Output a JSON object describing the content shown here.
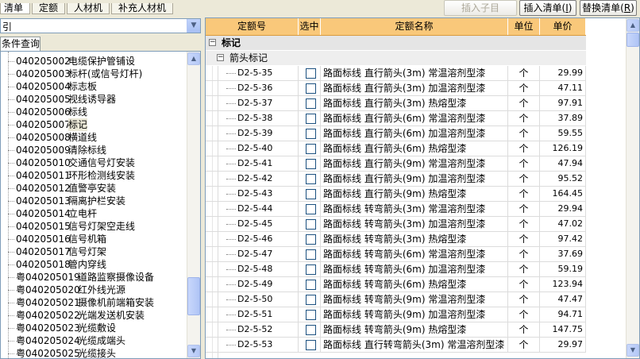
{
  "tabs": [
    "清单",
    "定额",
    "人材机",
    "补充人材机"
  ],
  "toolbar": {
    "insert_child": "插入子目",
    "insert_list": "插入清单(",
    "insert_list_key": "I",
    "insert_list_end": ")",
    "replace_list": "替换清单(",
    "replace_list_key": "R",
    "replace_list_end": ")"
  },
  "left": {
    "combo_value": "引",
    "tab_label": "条件查询",
    "tree": [
      {
        "code": "040205002",
        "name": "电缆保护管铺设"
      },
      {
        "code": "040205003",
        "name": "标杆(或信号灯杆)"
      },
      {
        "code": "040205004",
        "name": "标志板"
      },
      {
        "code": "040205005",
        "name": "视线诱导器"
      },
      {
        "code": "040205006",
        "name": "标线"
      },
      {
        "code": "040205007",
        "name": "标记",
        "selected": true
      },
      {
        "code": "040205008",
        "name": "横道线"
      },
      {
        "code": "040205009",
        "name": "清除标线"
      },
      {
        "code": "040205010",
        "name": "交通信号灯安装"
      },
      {
        "code": "040205011",
        "name": "环形检测线安装"
      },
      {
        "code": "040205012",
        "name": "值警亭安装"
      },
      {
        "code": "040205013",
        "name": "隔离护栏安装"
      },
      {
        "code": "040205014",
        "name": "立电杆"
      },
      {
        "code": "040205015",
        "name": "信号灯架空走线"
      },
      {
        "code": "040205016",
        "name": "信号机箱"
      },
      {
        "code": "040205017",
        "name": "信号灯架"
      },
      {
        "code": "040205018",
        "name": "管内穿线"
      },
      {
        "code": "粤040205019",
        "name": "道路监察摄像设备"
      },
      {
        "code": "粤040205020",
        "name": "红外线光源"
      },
      {
        "code": "粤040205021",
        "name": "摄像机前端箱安装"
      },
      {
        "code": "粤040205022",
        "name": "光端发送机安装"
      },
      {
        "code": "粤040205023",
        "name": "光缆敷设"
      },
      {
        "code": "粤040205024",
        "name": "光缆成端头"
      },
      {
        "code": "粤040205025",
        "name": "光缆接头"
      }
    ]
  },
  "grid": {
    "headers": [
      "定额号",
      "选中",
      "定额名称",
      "单位",
      "单价"
    ],
    "group1": "标记",
    "group2": "箭头标记",
    "rows": [
      {
        "id": "D2-5-35",
        "name": "路面标线 直行箭头(3m) 常温溶剂型漆",
        "unit": "个",
        "price": "29.99"
      },
      {
        "id": "D2-5-36",
        "name": "路面标线 直行箭头(3m) 加温溶剂型漆",
        "unit": "个",
        "price": "47.11"
      },
      {
        "id": "D2-5-37",
        "name": "路面标线 直行箭头(3m) 热熔型漆",
        "unit": "个",
        "price": "97.91"
      },
      {
        "id": "D2-5-38",
        "name": "路面标线 直行箭头(6m) 常温溶剂型漆",
        "unit": "个",
        "price": "37.89"
      },
      {
        "id": "D2-5-39",
        "name": "路面标线 直行箭头(6m) 加温溶剂型漆",
        "unit": "个",
        "price": "59.55"
      },
      {
        "id": "D2-5-40",
        "name": "路面标线 直行箭头(6m) 热熔型漆",
        "unit": "个",
        "price": "126.19"
      },
      {
        "id": "D2-5-41",
        "name": "路面标线 直行箭头(9m) 常温溶剂型漆",
        "unit": "个",
        "price": "47.94"
      },
      {
        "id": "D2-5-42",
        "name": "路面标线 直行箭头(9m) 加温溶剂型漆",
        "unit": "个",
        "price": "95.52"
      },
      {
        "id": "D2-5-43",
        "name": "路面标线 直行箭头(9m) 热熔型漆",
        "unit": "个",
        "price": "164.45"
      },
      {
        "id": "D2-5-44",
        "name": "路面标线 转弯箭头(3m) 常温溶剂型漆",
        "unit": "个",
        "price": "29.94"
      },
      {
        "id": "D2-5-45",
        "name": "路面标线 转弯箭头(3m) 加温溶剂型漆",
        "unit": "个",
        "price": "47.02"
      },
      {
        "id": "D2-5-46",
        "name": "路面标线 转弯箭头(3m) 热熔型漆",
        "unit": "个",
        "price": "97.42"
      },
      {
        "id": "D2-5-47",
        "name": "路面标线 转弯箭头(6m) 常温溶剂型漆",
        "unit": "个",
        "price": "37.69"
      },
      {
        "id": "D2-5-48",
        "name": "路面标线 转弯箭头(6m) 加温溶剂型漆",
        "unit": "个",
        "price": "59.19"
      },
      {
        "id": "D2-5-49",
        "name": "路面标线 转弯箭头(6m) 热熔型漆",
        "unit": "个",
        "price": "123.94"
      },
      {
        "id": "D2-5-50",
        "name": "路面标线 转弯箭头(9m) 常温溶剂型漆",
        "unit": "个",
        "price": "47.47"
      },
      {
        "id": "D2-5-51",
        "name": "路面标线 转弯箭头(9m) 加温溶剂型漆",
        "unit": "个",
        "price": "94.71"
      },
      {
        "id": "D2-5-52",
        "name": "路面标线 转弯箭头(9m) 热熔型漆",
        "unit": "个",
        "price": "147.75"
      },
      {
        "id": "D2-5-53",
        "name": "路面标线 直行转弯箭头(3m) 常温溶剂型漆",
        "unit": "个",
        "price": "29.97"
      }
    ]
  },
  "colors": {
    "header": "#F9C87A",
    "group": "#E5E5E5",
    "window": "#ECE9D8"
  }
}
